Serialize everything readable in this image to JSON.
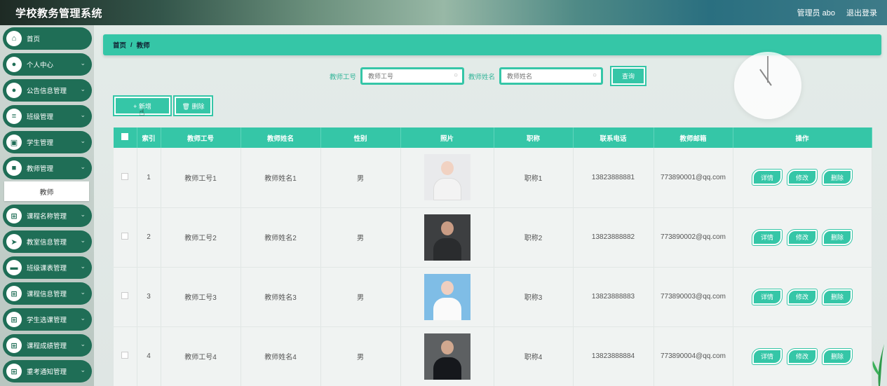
{
  "header": {
    "title": "学校教务管理系统",
    "user": "管理员 abo",
    "logout": "退出登录"
  },
  "sidebar": {
    "items": [
      {
        "label": "首页",
        "icon": "home-icon",
        "glyph": "⌂",
        "chevron": false
      },
      {
        "label": "个人中心",
        "icon": "user-icon",
        "glyph": "●",
        "chevron": true
      },
      {
        "label": "公告信息管理",
        "icon": "user-icon",
        "glyph": "●",
        "chevron": true
      },
      {
        "label": "班级管理",
        "icon": "list-icon",
        "glyph": "≡",
        "chevron": true
      },
      {
        "label": "学生管理",
        "icon": "id-card-icon",
        "glyph": "▣",
        "chevron": true
      },
      {
        "label": "教师管理",
        "icon": "lock-icon",
        "glyph": "■",
        "chevron": true
      },
      {
        "label": "课程名称管理",
        "icon": "grid-icon",
        "glyph": "⊞",
        "chevron": true
      },
      {
        "label": "教室信息管理",
        "icon": "send-icon",
        "glyph": "➤",
        "chevron": true
      },
      {
        "label": "班级课表管理",
        "icon": "card-icon",
        "glyph": "▬",
        "chevron": true
      },
      {
        "label": "课程信息管理",
        "icon": "grid-icon",
        "glyph": "⊞",
        "chevron": true
      },
      {
        "label": "学生选课管理",
        "icon": "grid-icon",
        "glyph": "⊞",
        "chevron": true
      },
      {
        "label": "课程成绩管理",
        "icon": "grid-icon",
        "glyph": "⊞",
        "chevron": true
      },
      {
        "label": "重考通知管理",
        "icon": "grid-icon",
        "glyph": "⊞",
        "chevron": true
      }
    ],
    "submenu": {
      "label": "教师"
    }
  },
  "breadcrumb": {
    "home": "首页",
    "separator": "/",
    "current": "教师"
  },
  "search": {
    "id_label": "教师工号",
    "id_placeholder": "教师工号",
    "name_label": "教师姓名",
    "name_placeholder": "教师姓名",
    "query_button": "查询"
  },
  "actions": {
    "add": "+ 新增",
    "delete": "🗑 删除"
  },
  "table": {
    "columns": [
      "索引",
      "教师工号",
      "教师姓名",
      "性别",
      "照片",
      "职称",
      "联系电话",
      "教师邮箱",
      "操作"
    ],
    "rows": [
      {
        "index": "1",
        "id": "教师工号1",
        "name": "教师姓名1",
        "gender": "男",
        "title": "职称1",
        "phone": "13823888881",
        "email": "773890001@qq.com"
      },
      {
        "index": "2",
        "id": "教师工号2",
        "name": "教师姓名2",
        "gender": "男",
        "title": "职称2",
        "phone": "13823888882",
        "email": "773890002@qq.com"
      },
      {
        "index": "3",
        "id": "教师工号3",
        "name": "教师姓名3",
        "gender": "男",
        "title": "职称3",
        "phone": "13823888883",
        "email": "773890003@qq.com"
      },
      {
        "index": "4",
        "id": "教师工号4",
        "name": "教师姓名4",
        "gender": "男",
        "title": "职称4",
        "phone": "13823888884",
        "email": "773890004@qq.com"
      }
    ],
    "row_actions": {
      "detail": "详情",
      "edit": "修改",
      "delete": "删除"
    }
  },
  "colors": {
    "accent": "#35c6a7",
    "sidebar_item": "#1f6e56"
  }
}
